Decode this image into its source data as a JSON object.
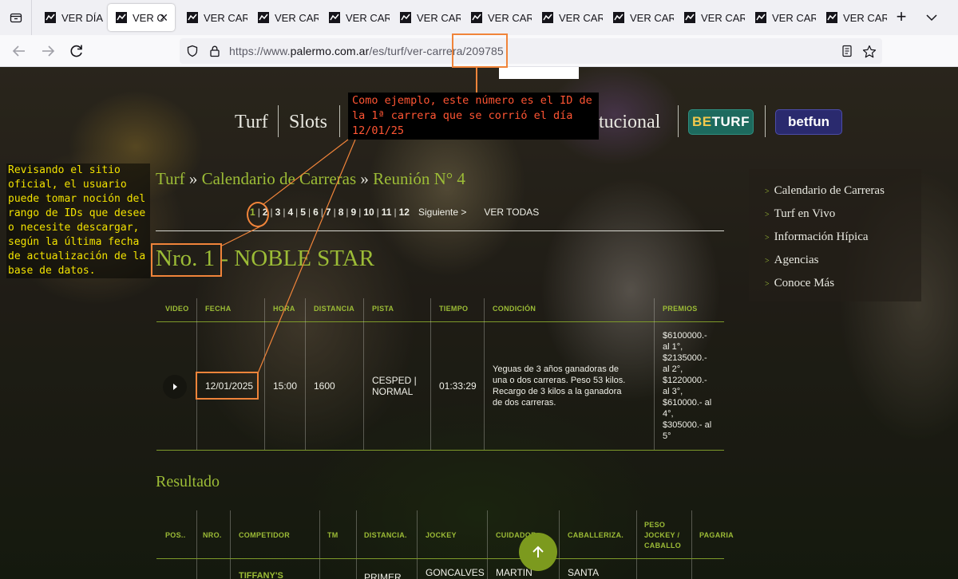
{
  "browser": {
    "tabs": [
      {
        "label": "VER DÍA",
        "active": false
      },
      {
        "label": "VER C",
        "active": true
      },
      {
        "label": "VER CAR",
        "active": false
      },
      {
        "label": "VER CAR",
        "active": false
      },
      {
        "label": "VER CAR",
        "active": false
      },
      {
        "label": "VER CAR",
        "active": false
      },
      {
        "label": "VER CAR",
        "active": false
      },
      {
        "label": "VER CAR",
        "active": false
      },
      {
        "label": "VER CAR",
        "active": false
      },
      {
        "label": "VER CAR",
        "active": false
      },
      {
        "label": "VER CAR",
        "active": false
      },
      {
        "label": "VER CAR",
        "active": false
      }
    ],
    "new_tab_label": "+",
    "url": {
      "scheme": "https://www.",
      "host": "palermo.com.ar",
      "path": "/es/turf/ver-carrera/209785"
    }
  },
  "site": {
    "nav": {
      "turf": "Turf",
      "slots": "Slots",
      "institucional": "tucional",
      "beturf_be": "BE",
      "beturf_turf": "TURF",
      "betfun": "betfun"
    },
    "breadcrumb": {
      "turf": "Turf",
      "sep": "»",
      "calendario": "Calendario de Carreras",
      "reunion": "Reunión N° 4"
    },
    "pager": {
      "pages": [
        "1",
        "2",
        "3",
        "4",
        "5",
        "6",
        "7",
        "8",
        "9",
        "10",
        "11",
        "12"
      ],
      "current": "1",
      "next": "Siguiente >",
      "all": "VER TODAS"
    },
    "race_title": {
      "number": "Nro. 1",
      "name": "- NOBLE STAR"
    },
    "sidebar": [
      "Calendario de Carreras",
      "Turf en Vivo",
      "Información Hípica",
      "Agencias",
      "Conoce Más"
    ],
    "race_table": {
      "headers": [
        "VIDEO",
        "FECHA",
        "HORA",
        "DISTANCIA",
        "PISTA",
        "TIEMPO",
        "CONDICIÓN",
        "PREMIOS"
      ],
      "row": {
        "fecha": "12/01/2025",
        "hora": "15:00",
        "distancia": "1600",
        "pista_1": "CESPED |",
        "pista_2": "NORMAL",
        "tiempo": "01:33:29",
        "condicion": "Yeguas de 3 años ganadoras de una o dos carreras. Peso 53 kilos. Recargo de 3 kilos a la ganadora de dos carreras.",
        "premios": [
          "$6100000.-",
          "al 1°,",
          "$2135000.-",
          "al 2°,",
          "$1220000.-",
          "al 3°,",
          "$610000.- al",
          "4°,",
          "$305000.- al",
          "5°"
        ]
      }
    },
    "result": {
      "title": "Resultado",
      "headers": [
        "POS..",
        "NRO.",
        "COMPETIDOR",
        "TM",
        "DISTANCIA.",
        "JOCKEY",
        "CUIDADOR",
        "CABALLERIZA.",
        "PESO JOCKEY / CABALLO",
        "PAGARIA"
      ],
      "first_row": {
        "competidor": "TIFFANY'S",
        "distancia": "PRIMER",
        "jockey": "GONCALVES",
        "cuidador": "MARTIN",
        "caballeriza": "SANTA"
      }
    }
  },
  "annotations": {
    "left_note": "Revisando el sitio oficial, el usuario puede tomar noción del rango de IDs que desee o necesite descargar, según la última fecha de actualización de la base de datos.",
    "top_note": "Como ejemplo, este número es el ID de la 1ª carrera que se corrió el día 12/01/25"
  },
  "colors": {
    "accent_green": "#9cbc36",
    "annotation_orange": "#f0843a",
    "annotation_yellow": "#f2e200",
    "annotation_red": "#ff5533"
  }
}
